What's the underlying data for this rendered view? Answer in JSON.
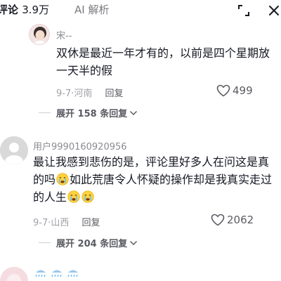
{
  "header": {
    "comments_tab": "评论",
    "comments_count": "3.9万",
    "ai_tab": "AI 解析",
    "expand_icon": "expand-icon",
    "close_icon": "close-icon"
  },
  "comments": [
    {
      "username": "宋--",
      "lines": [
        "双休是最近一年才有的，以前是四个星期放",
        "一天半的假"
      ],
      "date": "9-7",
      "location": "河南",
      "reply_label": "回复",
      "likes": "499",
      "expand_label": "展开 158 条回复"
    },
    {
      "username": "用户9990160920956",
      "line1": "最让我感到悲伤的是，评论里好多人在问这是真",
      "line2_a": "的吗",
      "line2_b": "如此荒唐令人怀疑的操作却是我真实走过",
      "line3": "的人生",
      "date": "9-7",
      "location": "山西",
      "reply_label": "回复",
      "likes": "2062",
      "expand_label": "展开 204 条回复"
    }
  ],
  "icons": {
    "heart": "heart-outline-icon",
    "chevron": "chevron-down-icon",
    "crying_emoji": "crying-face-emoji",
    "sweat_emoji": "sweat-drops-emoji"
  },
  "colors": {
    "text_primary": "#161823",
    "text_secondary": "#8a8b91",
    "emoji_blue": "#6ec3f4"
  }
}
